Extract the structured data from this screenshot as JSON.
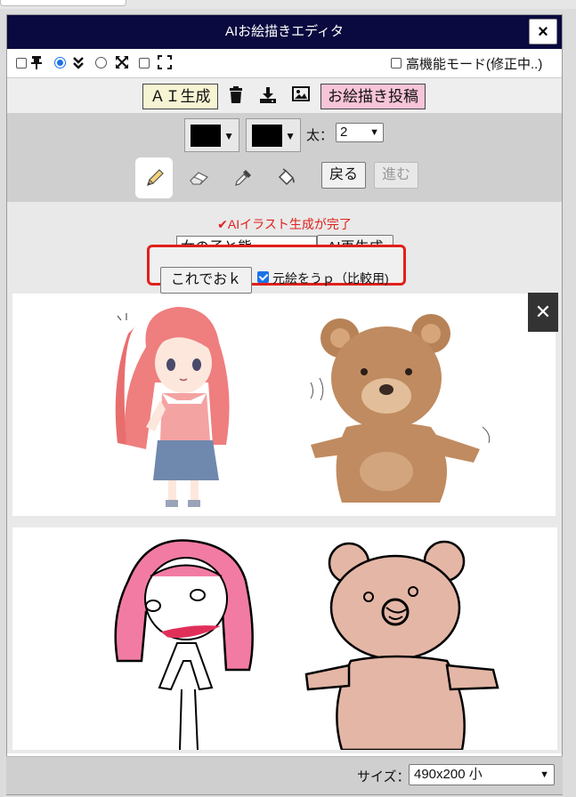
{
  "window": {
    "title": "AIお絵描きエディタ",
    "close_label": "×"
  },
  "options": {
    "pin_checked": false,
    "advanced_mode_label": "高機能モード(修正中..)",
    "advanced_mode_checked": false
  },
  "toolbar": {
    "ai_generate_label": "ＡＩ生成",
    "post_label": "お絵描き投稿"
  },
  "drawing": {
    "color1": "#000000",
    "color2": "#000000",
    "thickness_label": "太：",
    "thickness_value": "2",
    "back_label": "戻る",
    "forward_label": "進む"
  },
  "ai_panel": {
    "status_text": "✔AIイラスト生成が完了",
    "prompt_value": "女の子と熊",
    "regenerate_label": "AI再生成",
    "accept_label": "これでおｋ",
    "compare_label": "元絵をうｐ（比較用)",
    "compare_checked": true
  },
  "footer": {
    "size_label": "サイズ：",
    "size_value": "490x200 小"
  },
  "colors": {
    "title_bg": "#0a0a40",
    "ai_button_bg": "#f6f4d2",
    "post_button_bg": "#f7c4d8",
    "status_color": "#e0201a",
    "highlight_border": "#e0201a"
  }
}
